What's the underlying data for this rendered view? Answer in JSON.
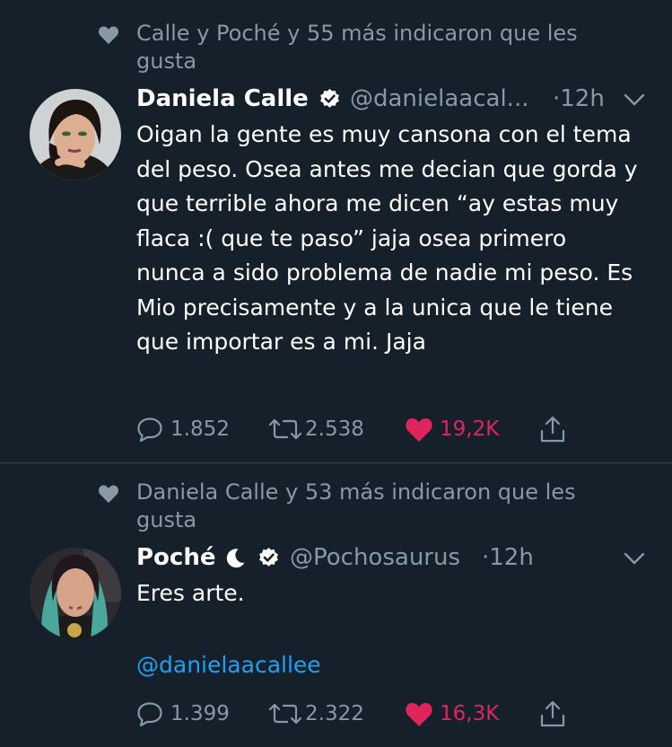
{
  "tweets": [
    {
      "social_context": "Calle y Poché y 55 más indicaron que les gusta",
      "display_name": "Daniela Calle",
      "handle": "@danielaacal...",
      "time": "·12h",
      "text": "Oigan la gente es muy cansona con el tema del peso. Osea antes me decian que gorda y que terrible ahora me dicen “ay estas muy flaca :( que te paso” jaja osea primero nunca a sido problema de nadie mi peso. Es Mio precisamente y a la unica que le tiene que importar es a mi. Jaja",
      "mention": "",
      "replies": "1.852",
      "retweets": "2.538",
      "likes": "19,2K",
      "liked": true
    },
    {
      "social_context": "Daniela Calle y 53 más indicaron que les gusta",
      "display_name": "Poché",
      "handle": "@Pochosaurus",
      "time": "·12h",
      "text": "Eres arte.",
      "mention": "@danielaacallee",
      "replies": "1.399",
      "retweets": "2.322",
      "likes": "16,3K",
      "liked": true
    }
  ],
  "icons": {
    "social": "heart-icon",
    "verified": "verified-badge-icon",
    "moon": "crescent-moon-icon",
    "menu": "chevron-down-icon",
    "reply": "reply-icon",
    "retweet": "retweet-icon",
    "like": "heart-filled-icon",
    "share": "share-icon"
  },
  "colors": {
    "background": "#15202b",
    "text": "#ffffff",
    "secondary": "#8899a6",
    "link": "#1da1f2",
    "like": "#e0245e",
    "verified_badge": "#ffffff",
    "divider": "#38444d"
  }
}
